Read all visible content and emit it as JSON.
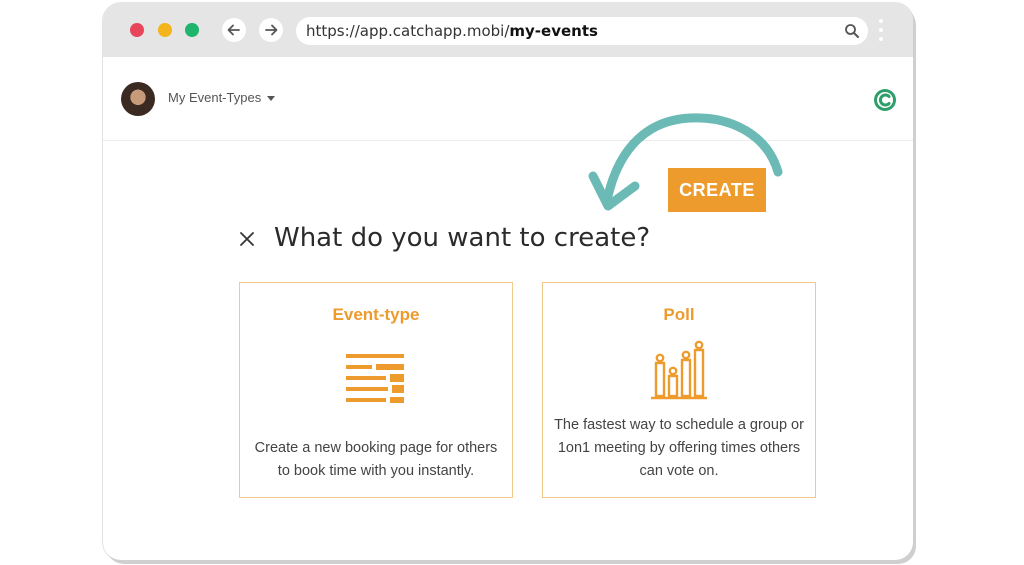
{
  "browser": {
    "url_prefix": "https://app.catchapp.mobi/",
    "url_path": "my-events"
  },
  "header": {
    "menu_label": "My Event-Types"
  },
  "create_button_label": "CREATE",
  "dialog": {
    "title": "What do you want to create?",
    "close_symbol": "×",
    "cards": [
      {
        "title": "Event-type",
        "description": "Create a new booking page for others to book time with you instantly.",
        "icon": "list-icon"
      },
      {
        "title": "Poll",
        "description": "The fastest way to schedule a group or 1on1 meeting by offering times others can vote on.",
        "icon": "poll-bars-icon"
      }
    ]
  },
  "colors": {
    "accent": "#ee9b2d",
    "card_border": "#f0c88a",
    "arrow": "#6bbab5",
    "titlebar": "#e5e5e5"
  }
}
